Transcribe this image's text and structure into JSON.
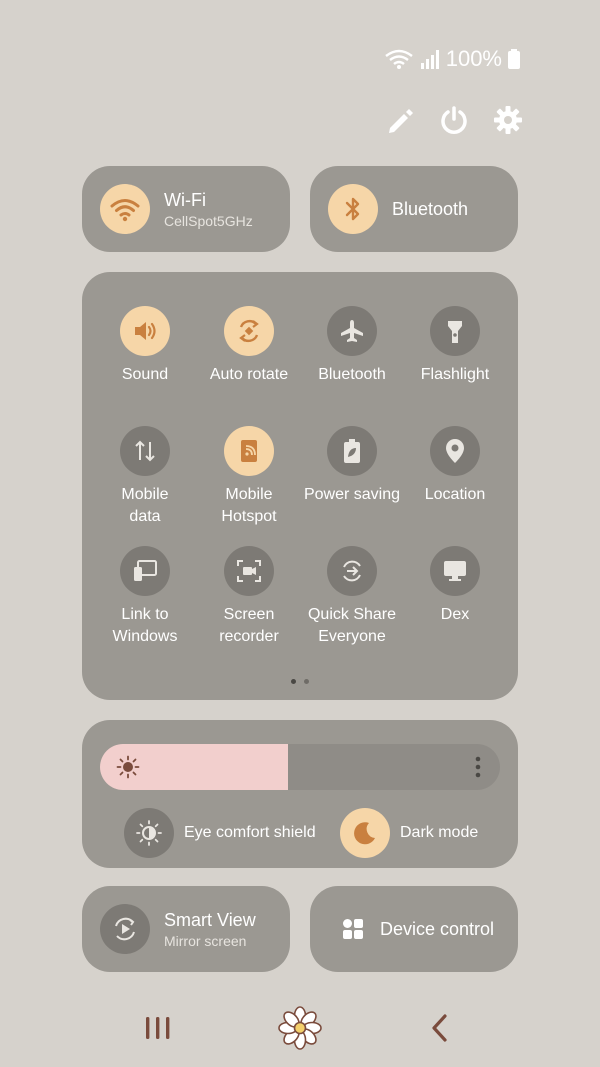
{
  "status_bar": {
    "battery_text": "100%"
  },
  "toolbar": {
    "edit_icon": "pencil-icon",
    "power_icon": "power-icon",
    "settings_icon": "gear-icon"
  },
  "top_tiles": {
    "wifi": {
      "title": "Wi-Fi",
      "subtitle": "CellSpot5GHz",
      "state": "on"
    },
    "bluetooth": {
      "title": "Bluetooth",
      "state": "on"
    }
  },
  "quick_tiles": [
    {
      "label": "Sound",
      "icon": "speaker-icon",
      "state": "on"
    },
    {
      "label": "Auto rotate",
      "icon": "rotate-icon",
      "state": "on"
    },
    {
      "label": "Bluetooth",
      "icon": "airplane-icon",
      "state": "off"
    },
    {
      "label": "Flashlight",
      "icon": "flashlight-icon",
      "state": "off"
    },
    {
      "label": "Mobile\ndata",
      "icon": "data-arrows-icon",
      "state": "off"
    },
    {
      "label": "Mobile\nHotspot",
      "icon": "hotspot-icon",
      "state": "on"
    },
    {
      "label": "Power saving",
      "icon": "battery-leaf-icon",
      "state": "off"
    },
    {
      "label": "Location",
      "icon": "location-pin-icon",
      "state": "off"
    },
    {
      "label": "Link to\nWindows",
      "icon": "link-windows-icon",
      "state": "off"
    },
    {
      "label": "Screen\nrecorder",
      "icon": "screen-recorder-icon",
      "state": "off"
    },
    {
      "label": "Quick Share\nEveryone",
      "icon": "quick-share-icon",
      "state": "off"
    },
    {
      "label": "Dex",
      "icon": "dex-icon",
      "state": "off"
    }
  ],
  "pager": {
    "pages": 2,
    "current": 1
  },
  "brightness": {
    "level": 0.47
  },
  "bottom_pills": {
    "eye_comfort": {
      "label": "Eye comfort shield",
      "state": "off"
    },
    "dark_mode": {
      "label": "Dark mode",
      "state": "on"
    }
  },
  "bottom_tiles": {
    "smart_view": {
      "title": "Smart View",
      "subtitle": "Mirror screen"
    },
    "device_control": {
      "title": "Device control"
    }
  },
  "colors": {
    "accent": "#f6d6a8",
    "accent_icon": "#c9803f",
    "tile_bg": "#9b9892",
    "brightness_fill": "#f2cfcd",
    "nav_icon": "#7a4b3c"
  }
}
